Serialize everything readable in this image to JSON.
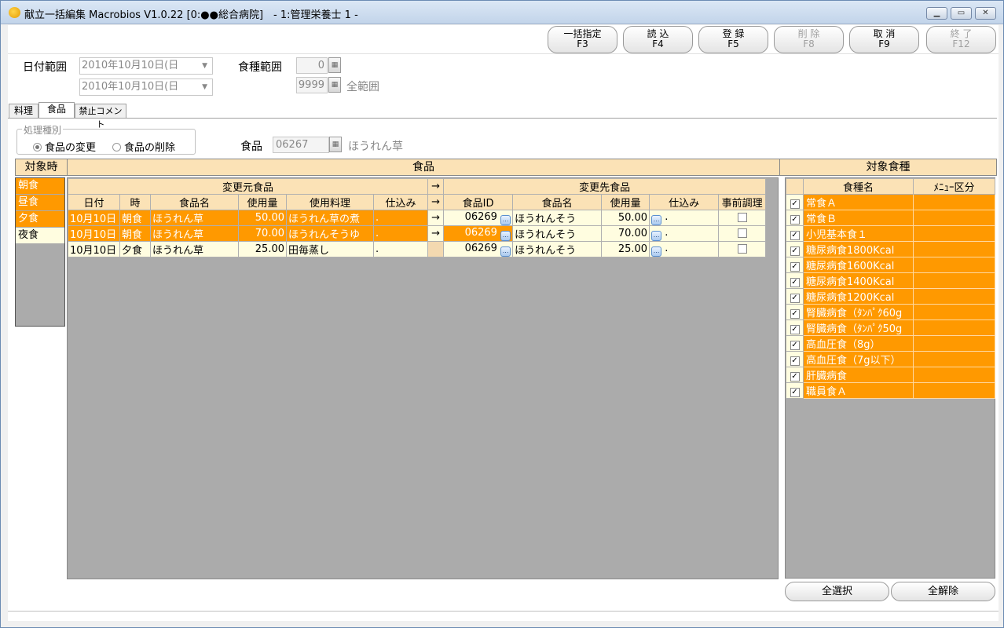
{
  "window": {
    "title": "献立一括編集 Macrobios V1.0.22 [0:●●総合病院]　- 1:管理栄養士 1 -"
  },
  "toolbar": [
    {
      "label": "一括指定",
      "key": "F3",
      "enabled": true
    },
    {
      "label": "読 込",
      "key": "F4",
      "enabled": true
    },
    {
      "label": "登 録",
      "key": "F5",
      "enabled": true
    },
    {
      "label": "削 除",
      "key": "F8",
      "enabled": false
    },
    {
      "label": "取 消",
      "key": "F9",
      "enabled": true
    },
    {
      "label": "終 了",
      "key": "F12",
      "enabled": false
    }
  ],
  "filters": {
    "date_label": "日付範囲",
    "date_from": "2010年10月10日(日",
    "date_to": "2010年10月10日(日",
    "meal_label": "食種範囲",
    "meal_from": "0",
    "meal_to": "9999",
    "meal_all": "全範囲"
  },
  "tabs": [
    "料理",
    "食品",
    "禁止コメント"
  ],
  "process": {
    "title": "処理種別",
    "opt_change": "食品の変更",
    "opt_delete": "食品の削除",
    "food_label": "食品",
    "food_code": "06267",
    "food_name": "ほうれん草"
  },
  "headers": {
    "target_time": "対象時",
    "food": "食品",
    "target_meal": "対象食種"
  },
  "meal_times": [
    "朝食",
    "昼食",
    "夕食",
    "夜食"
  ],
  "grid": {
    "src_caption": "変更元食品",
    "dst_caption": "変更先食品",
    "arrow": "→",
    "cols": [
      "日付",
      "時",
      "食品名",
      "使用量",
      "使用料理",
      "仕込み",
      "→",
      "食品ID",
      "食品名",
      "使用量",
      "仕込み",
      "事前調理"
    ],
    "rows": [
      {
        "date": "10月10日",
        "time": "朝食",
        "food": "ほうれん草",
        "qty": "50.00",
        "dish": "ほうれん草の煮",
        "prep": ".",
        "arrow": "→",
        "id": "06269",
        "new_food": "ほうれんそう",
        "new_qty": "50.00",
        "new_prep": ".",
        "btn": "..."
      },
      {
        "date": "10月10日",
        "time": "朝食",
        "food": "ほうれん草",
        "qty": "70.00",
        "dish": "ほうれんそうゆ",
        "prep": ".",
        "arrow": "→",
        "id": "06269",
        "new_food": "ほうれんそう",
        "new_qty": "70.00",
        "new_prep": ".",
        "btn": "..."
      },
      {
        "date": "10月10日",
        "time": "夕食",
        "food": "ほうれん草",
        "qty": "25.00",
        "dish": "田毎蒸し",
        "prep": ".",
        "arrow": "",
        "id": "06269",
        "new_food": "ほうれんそう",
        "new_qty": "25.00",
        "new_prep": ".",
        "btn": "..."
      }
    ]
  },
  "meal_types": {
    "col_name": "食種名",
    "col_menu": "ﾒﾆｭｰ区分",
    "check": "✓",
    "items": [
      "常食Ａ",
      "常食Ｂ",
      "小児基本食１",
      "糖尿病食1800Kcal",
      "糖尿病食1600Kcal",
      "糖尿病食1400Kcal",
      "糖尿病食1200Kcal",
      "腎臓病食（ﾀﾝﾊﾟｸ60g",
      "腎臓病食（ﾀﾝﾊﾟｸ50g",
      "高血圧食（8g）",
      "高血圧食（7g以下）",
      "肝臓病食",
      "職員食Ａ"
    ]
  },
  "bottom": {
    "select_all": "全選択",
    "clear_all": "全解除"
  },
  "colors": {
    "orange": "#ff9900",
    "header": "#fbe2b6",
    "grey": "#ababab",
    "pale": "#fffde0"
  }
}
